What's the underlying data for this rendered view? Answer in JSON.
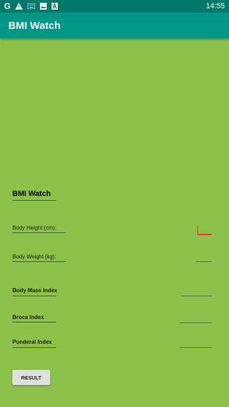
{
  "status_bar": {
    "icons": [
      "g-icon",
      "warning-icon",
      "keyboard-icon",
      "image-icon",
      "a-icon"
    ],
    "time": "14:55"
  },
  "app_bar": {
    "title": "BMI Watch"
  },
  "form": {
    "heading": "BMI Watch",
    "height_label": "Body Height (cm):",
    "weight_label": "Body Weight (kg):",
    "bmi_label": "Body Mass Index",
    "broca_label": "Broca Index",
    "ponderal_label": "Ponderal Index"
  },
  "result_button": "RESULT",
  "colors": {
    "status_bar": "#00796b",
    "app_bar": "#009688",
    "background": "#8bc34a",
    "focus_accent": "#e53935"
  }
}
